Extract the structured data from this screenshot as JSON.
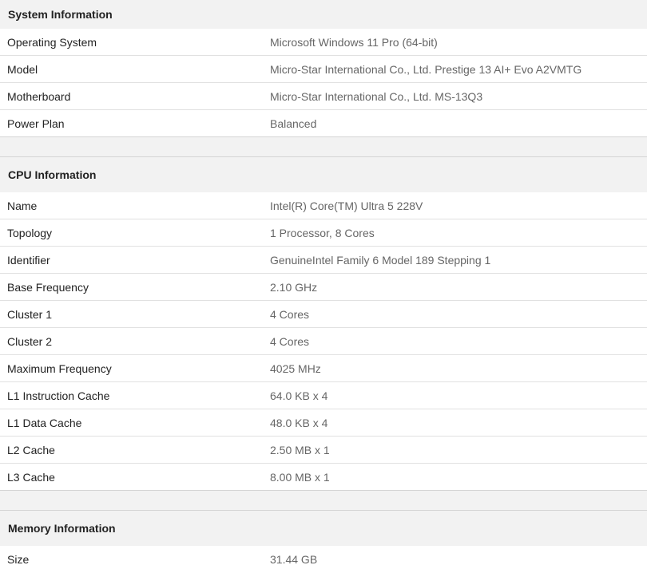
{
  "system": {
    "title": "System Information",
    "rows": [
      {
        "label": "Operating System",
        "value": "Microsoft Windows 11 Pro (64-bit)"
      },
      {
        "label": "Model",
        "value": "Micro-Star International Co., Ltd. Prestige 13 AI+ Evo A2VMTG"
      },
      {
        "label": "Motherboard",
        "value": "Micro-Star International Co., Ltd. MS-13Q3"
      },
      {
        "label": "Power Plan",
        "value": "Balanced"
      }
    ]
  },
  "cpu": {
    "title": "CPU Information",
    "rows": [
      {
        "label": "Name",
        "value": "Intel(R) Core(TM) Ultra 5 228V"
      },
      {
        "label": "Topology",
        "value": "1 Processor, 8 Cores"
      },
      {
        "label": "Identifier",
        "value": "GenuineIntel Family 6 Model 189 Stepping 1"
      },
      {
        "label": "Base Frequency",
        "value": "2.10 GHz"
      },
      {
        "label": "Cluster 1",
        "value": "4 Cores"
      },
      {
        "label": "Cluster 2",
        "value": "4 Cores"
      },
      {
        "label": "Maximum Frequency",
        "value": "4025 MHz"
      },
      {
        "label": "L1 Instruction Cache",
        "value": "64.0 KB x 4"
      },
      {
        "label": "L1 Data Cache",
        "value": "48.0 KB x 4"
      },
      {
        "label": "L2 Cache",
        "value": "2.50 MB x 1"
      },
      {
        "label": "L3 Cache",
        "value": "8.00 MB x 1"
      }
    ]
  },
  "memory": {
    "title": "Memory Information",
    "rows": [
      {
        "label": "Size",
        "value": "31.44 GB"
      }
    ]
  }
}
